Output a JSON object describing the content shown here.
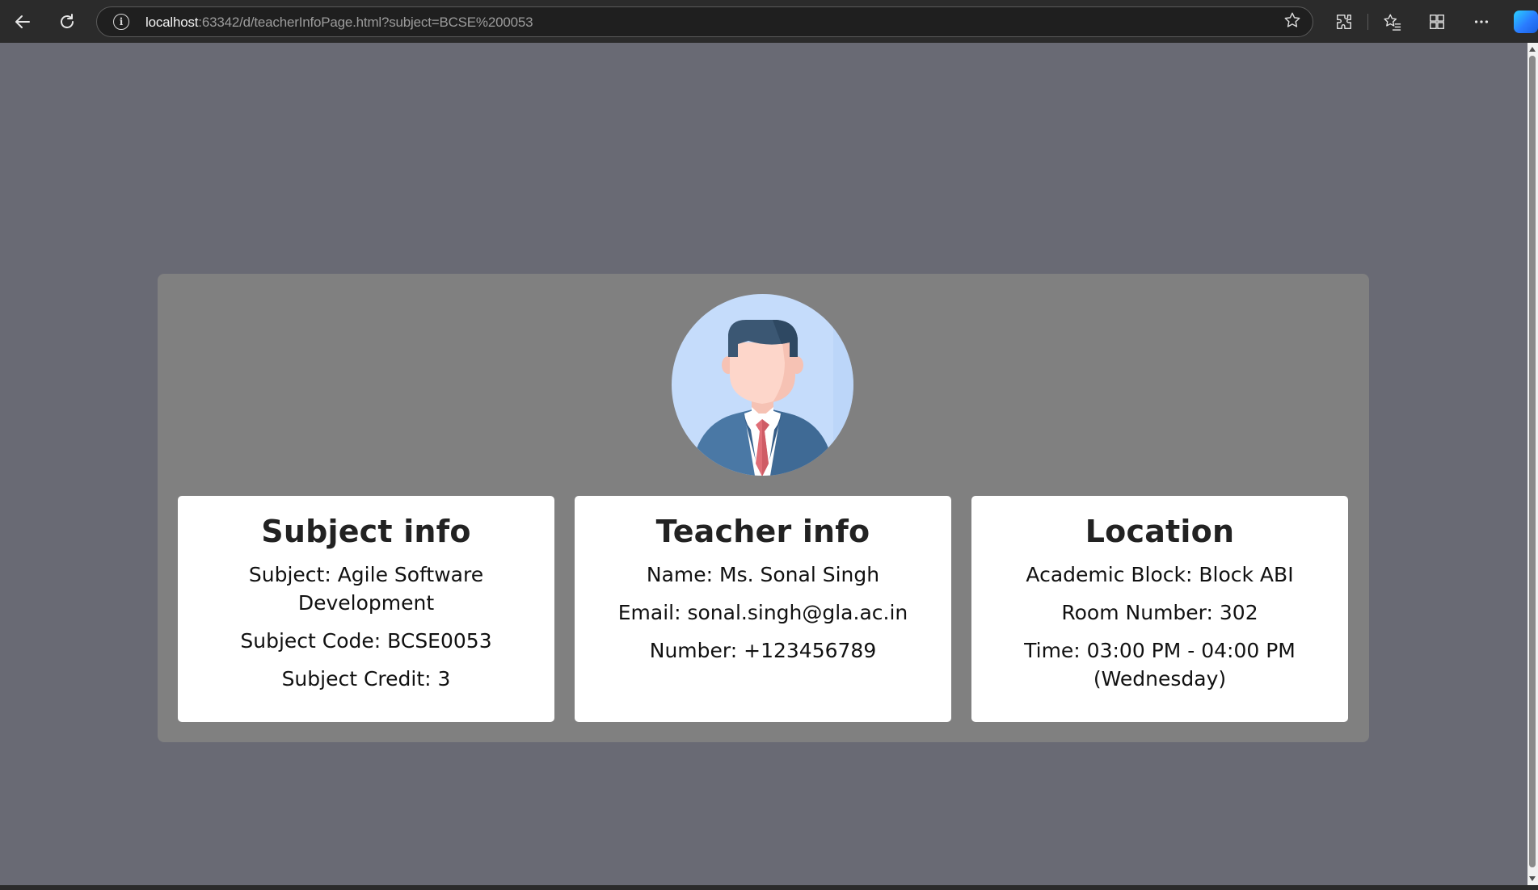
{
  "browser": {
    "url_host": "localhost",
    "url_rest": ":63342/d/teacherInfoPage.html?subject=BCSE%200053",
    "icons": [
      "back-icon",
      "reload-icon",
      "site-info-icon",
      "favorite-star-icon",
      "extensions-icon",
      "favorites-icon",
      "collections-icon",
      "more-icon",
      "copilot-icon"
    ]
  },
  "avatar": {
    "icon": "teacher-avatar-icon",
    "colors": {
      "background": "#c5dcfb",
      "hair": "#3b5773",
      "skin": "#fdd6ca",
      "suit": "#4a78a5",
      "tie": "#e06e77"
    }
  },
  "cards": {
    "subject": {
      "title": "Subject info",
      "subject": "Subject: Agile Software Development",
      "code": "Subject Code: BCSE0053",
      "credit": "Subject Credit: 3"
    },
    "teacher": {
      "title": "Teacher info",
      "name": "Name: Ms. Sonal Singh",
      "email": "Email: sonal.singh@gla.ac.in",
      "number": "Number: +123456789"
    },
    "location": {
      "title": "Location",
      "block": "Academic Block: Block ABI",
      "room": "Room Number: 302",
      "time": "Time: 03:00 PM - 04:00 PM (Wednesday)"
    }
  }
}
